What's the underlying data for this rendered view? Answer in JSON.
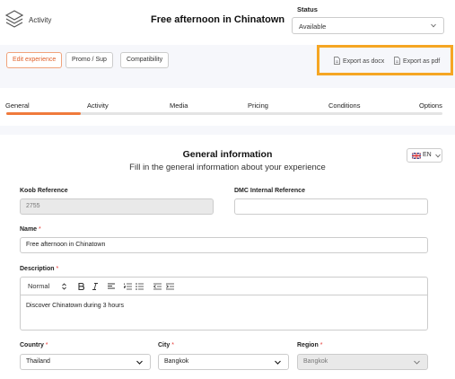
{
  "header": {
    "app_name": "Activity",
    "title": "Free afternoon in Chinatown",
    "status_label": "Status",
    "status_value": "Available"
  },
  "toolbar": {
    "buttons": [
      "Edit experience",
      "Promo / Sup",
      "Compatibility"
    ],
    "export_docx": "Export as docx",
    "export_pdf": "Export as pdf"
  },
  "tabs": [
    "General",
    "Activity",
    "Media",
    "Pricing",
    "Conditions",
    "Options"
  ],
  "progress": 0.17,
  "section": {
    "title": "General information",
    "subtitle": "Fill in the general information about your experience",
    "language": "EN"
  },
  "form": {
    "koob_reference": {
      "label": "Koob Reference",
      "value": "2755"
    },
    "dmc_reference": {
      "label": "DMC Internal Reference",
      "value": ""
    },
    "name": {
      "label": "Name",
      "required": "*",
      "value": "Free afternoon in Chinatown"
    },
    "description": {
      "label": "Description",
      "required": "*",
      "format": "Normal",
      "text": "Discover Chinatown during 3 hours"
    },
    "country": {
      "label": "Country",
      "required": "*",
      "value": "Thailand"
    },
    "city": {
      "label": "City",
      "required": "*",
      "value": "Bangkok"
    },
    "region": {
      "label": "Region",
      "required": "*",
      "value": "Bangkok"
    }
  },
  "colors": {
    "accent": "#f07a3c",
    "highlight_box": "#f5a623",
    "required": "#e53935"
  }
}
